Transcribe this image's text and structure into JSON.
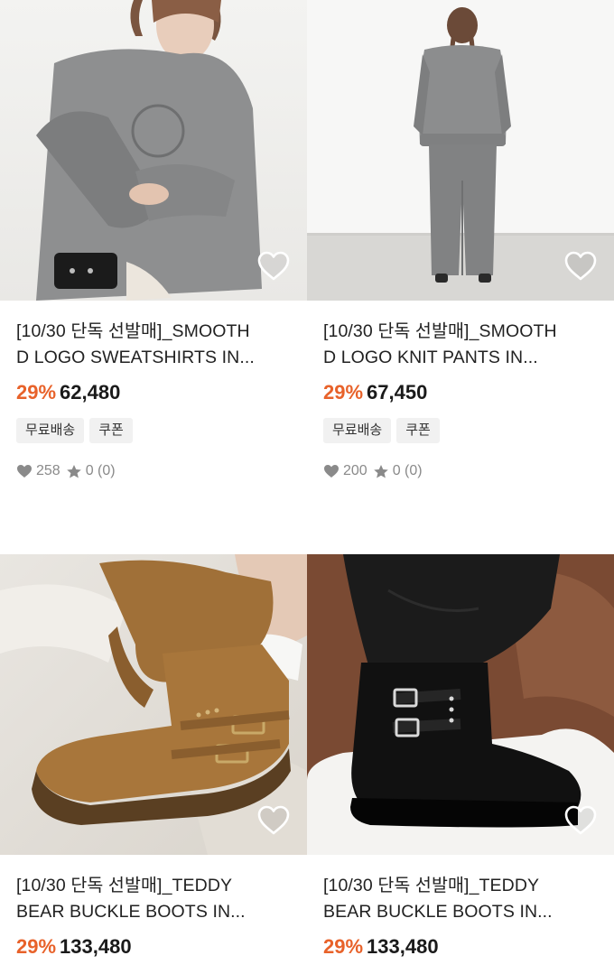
{
  "products": [
    {
      "title_line1": "[10/30 단독 선발매]_SMOOTH",
      "title_line2": "D LOGO SWEATSHIRTS IN...",
      "discount": "29%",
      "price": "62,480",
      "badges": [
        "무료배송",
        "쿠폰"
      ],
      "likes": "258",
      "rating": "0 (0)",
      "image": "model-grey-sweatshirt"
    },
    {
      "title_line1": "[10/30 단독 선발매]_SMOOTH",
      "title_line2": "D LOGO KNIT PANTS IN...",
      "discount": "29%",
      "price": "67,450",
      "badges": [
        "무료배송",
        "쿠폰"
      ],
      "likes": "200",
      "rating": "0 (0)",
      "image": "model-back-grey-knit-set"
    },
    {
      "title_line1": "[10/30 단독 선발매]_TEDDY",
      "title_line2": "BEAR BUCKLE BOOTS IN...",
      "discount": "29%",
      "price": "133,480",
      "image": "tan-suede-buckle-boots"
    },
    {
      "title_line1": "[10/30 단독 선발매]_TEDDY",
      "title_line2": "BEAR BUCKLE BOOTS IN...",
      "discount": "29%",
      "price": "133,480",
      "image": "black-suede-buckle-boots"
    }
  ],
  "colors": {
    "discount": "#e8622a",
    "price": "#1a1a1a",
    "badge_bg": "#f1f1f1",
    "stats": "#8a8a8a"
  },
  "icons": {
    "wishlist": "heart-outline-icon",
    "likes": "heart-filled-icon",
    "rating": "star-icon"
  }
}
